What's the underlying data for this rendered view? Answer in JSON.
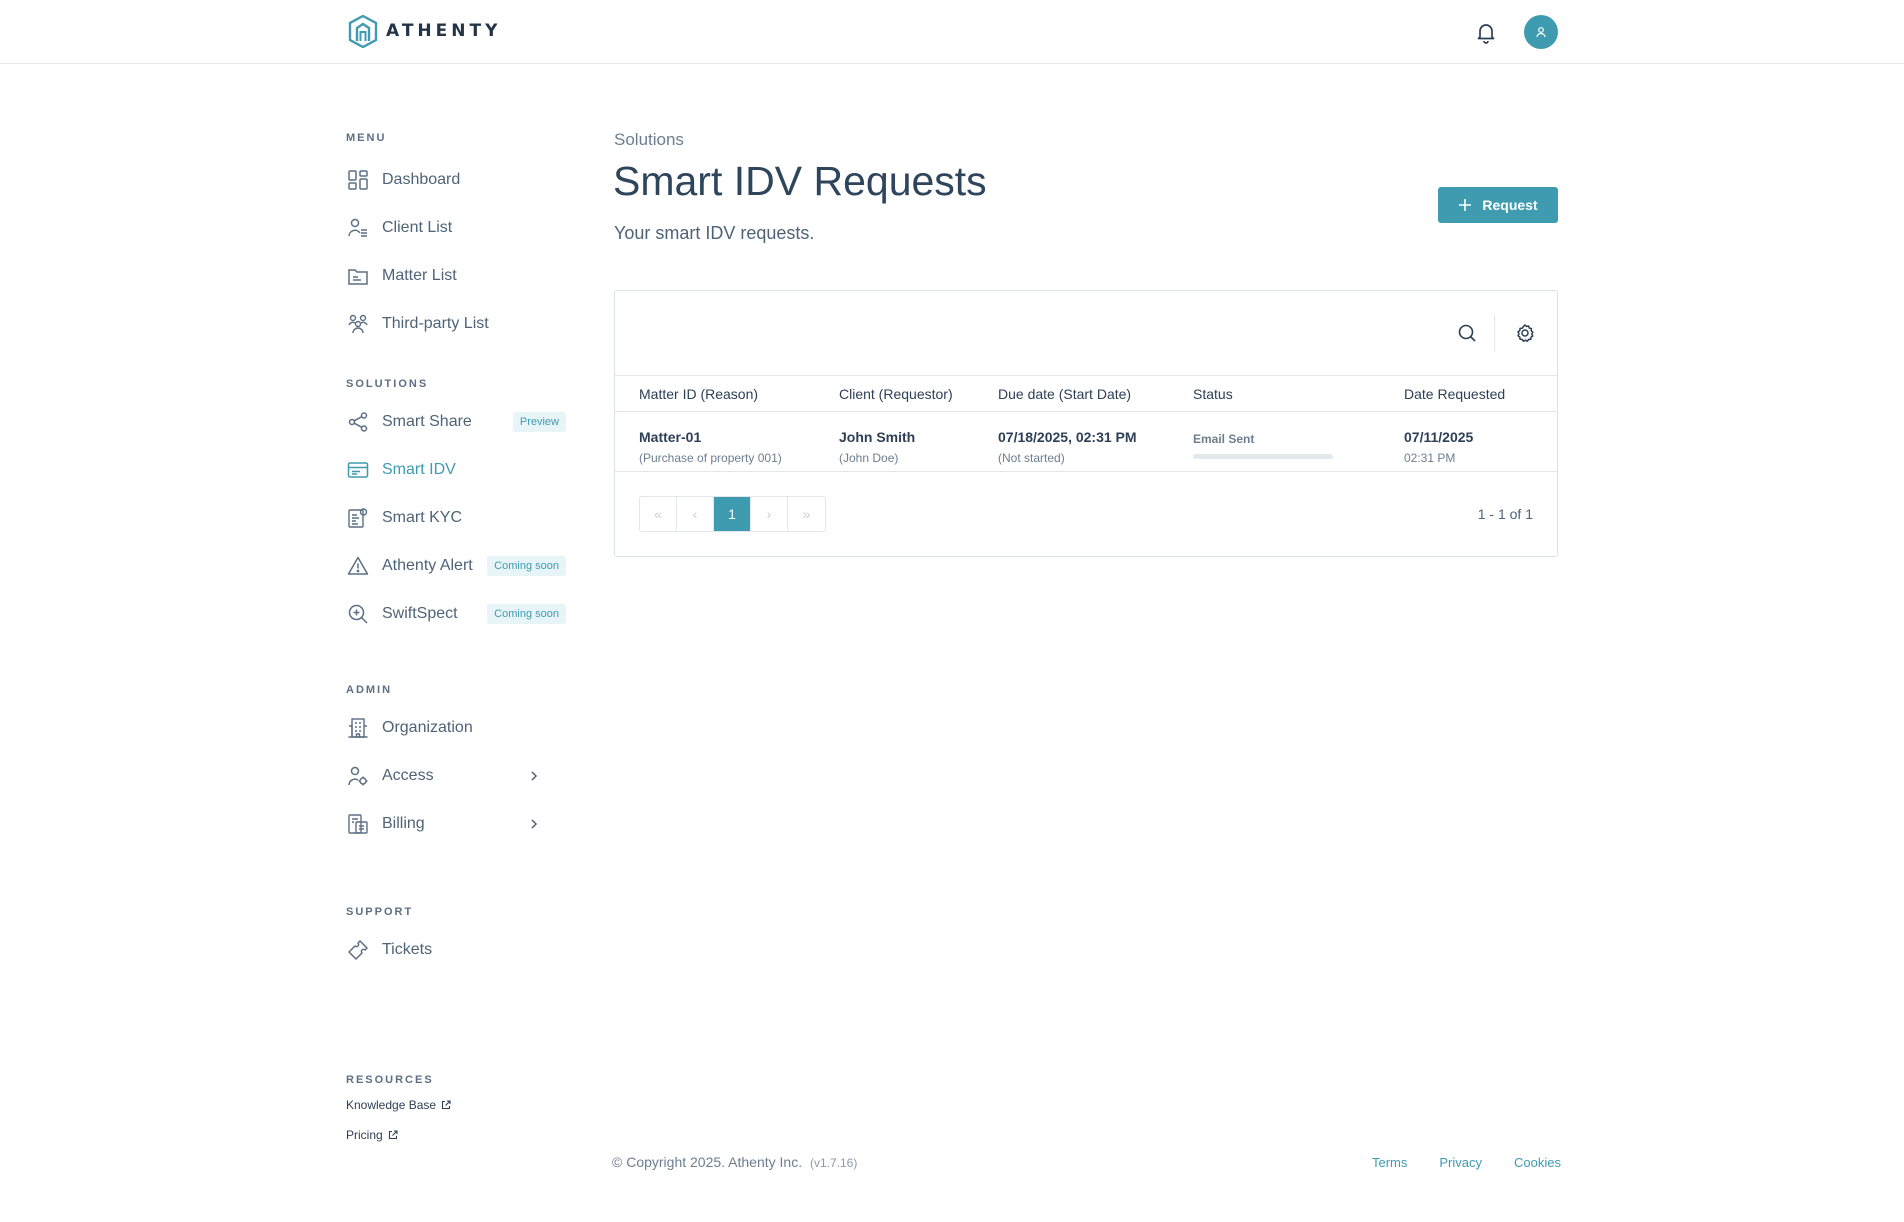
{
  "app": {
    "name": "ATHENTY"
  },
  "header": {
    "bell_icon": "bell-icon",
    "avatar_icon": "user-icon"
  },
  "colors": {
    "accent": "#3f9bb0",
    "text": "#2d3f55",
    "muted": "#6d7e90",
    "badge_bg": "#e7f4f8"
  },
  "sidebar": {
    "menu": {
      "label": "MENU",
      "items": [
        {
          "label": "Dashboard",
          "icon": "grid-icon"
        },
        {
          "label": "Client List",
          "icon": "client-list-icon"
        },
        {
          "label": "Matter List",
          "icon": "folder-icon"
        },
        {
          "label": "Third-party List",
          "icon": "group-icon"
        }
      ]
    },
    "solutions": {
      "label": "SOLUTIONS",
      "items": [
        {
          "label": "Smart Share",
          "icon": "share-icon",
          "badge": "Preview"
        },
        {
          "label": "Smart IDV",
          "icon": "id-card-icon",
          "active": true
        },
        {
          "label": "Smart KYC",
          "icon": "kyc-icon"
        },
        {
          "label": "Athenty Alert",
          "icon": "alert-icon",
          "badge": "Coming soon"
        },
        {
          "label": "SwiftSpect",
          "icon": "zoom-in-icon",
          "badge": "Coming soon"
        }
      ]
    },
    "admin": {
      "label": "ADMIN",
      "items": [
        {
          "label": "Organization",
          "icon": "building-icon"
        },
        {
          "label": "Access",
          "icon": "user-gear-icon"
        },
        {
          "label": "Billing",
          "icon": "billing-icon"
        }
      ]
    },
    "support": {
      "label": "SUPPORT",
      "items": [
        {
          "label": "Tickets",
          "icon": "ticket-icon"
        }
      ]
    },
    "resources": {
      "label": "RESOURCES",
      "links": [
        {
          "label": "Knowledge Base",
          "icon": "external-link-icon"
        },
        {
          "label": "Pricing",
          "icon": "external-link-icon"
        }
      ]
    }
  },
  "main": {
    "breadcrumb": "Solutions",
    "title": "Smart IDV Requests",
    "subtitle": "Your smart IDV requests.",
    "request_button": "Request",
    "table": {
      "columns": [
        "Matter ID (Reason)",
        "Client (Requestor)",
        "Due date (Start Date)",
        "Status",
        "Date Requested"
      ],
      "rows": [
        {
          "matter": "Matter-01",
          "reason": "(Purchase of property 001)",
          "client": "John Smith",
          "requestor": "(John Doe)",
          "due": "07/18/2025, 02:31 PM",
          "start": "(Not started)",
          "status": "Email Sent",
          "progress": 0,
          "date_requested": "07/11/2025",
          "time_requested": "02:31 PM"
        }
      ]
    },
    "pagination": {
      "first": "«",
      "prev": "‹",
      "current": "1",
      "next": "›",
      "last": "»",
      "range": "1 - 1 of 1"
    }
  },
  "footer": {
    "copyright": "© Copyright 2025. Athenty Inc.",
    "version": "(v1.7.16)",
    "links": [
      "Terms",
      "Privacy",
      "Cookies"
    ]
  }
}
